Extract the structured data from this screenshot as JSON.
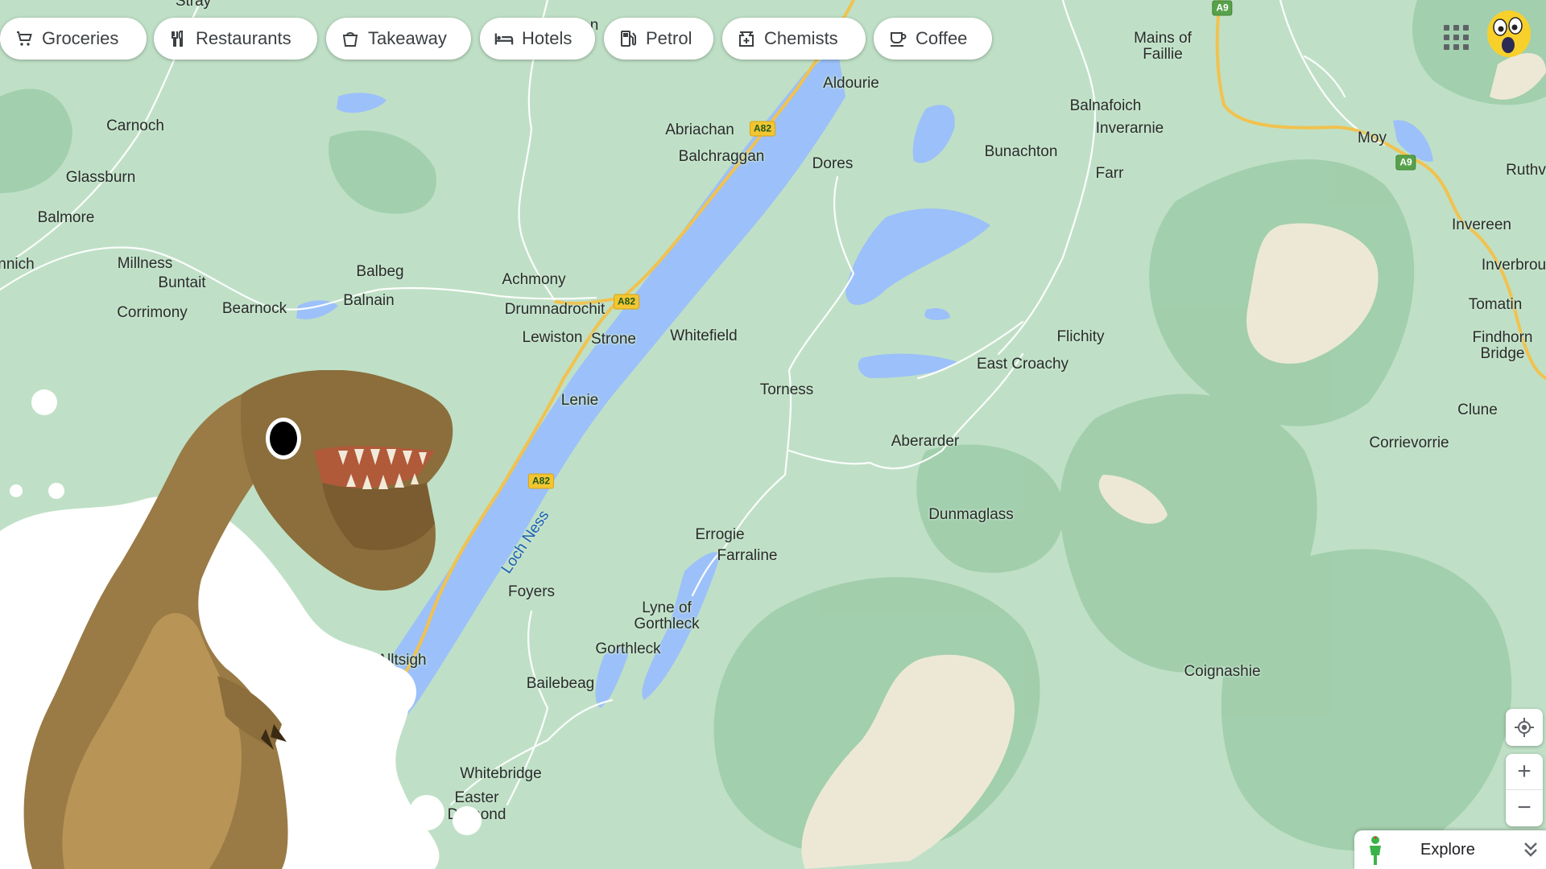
{
  "chips": [
    {
      "label": "Groceries",
      "icon": "cart-icon"
    },
    {
      "label": "Restaurants",
      "icon": "fork-knife-icon"
    },
    {
      "label": "Takeaway",
      "icon": "takeaway-bag-icon"
    },
    {
      "label": "Hotels",
      "icon": "bed-icon"
    },
    {
      "label": "Petrol",
      "icon": "fuel-pump-icon"
    },
    {
      "label": "Chemists",
      "icon": "pharmacy-icon"
    },
    {
      "label": "Coffee",
      "icon": "coffee-cup-icon"
    }
  ],
  "places": {
    "stray": "Stray",
    "n_partial": "n",
    "mains": "Mains of Faillie",
    "aldourie": "Aldourie",
    "balnafoich": "Balnafoich",
    "inverarnie": "Inverarnie",
    "moy": "Moy",
    "ruthv": "Ruthv",
    "carnoch": "Carnoch",
    "abriachan": "Abriachan",
    "balchraggan": "Balchraggan",
    "dores": "Dores",
    "bunachton": "Bunachton",
    "farr": "Farr",
    "glassburn": "Glassburn",
    "balmore": "Balmore",
    "invereen": "Invereen",
    "inverbrou": "Inverbrou",
    "nnich": "nnich",
    "millness": "Millness",
    "buntait": "Buntait",
    "corrimony": "Corrimony",
    "bearnock": "Bearnock",
    "balbeg": "Balbeg",
    "balnain": "Balnain",
    "achmony": "Achmony",
    "drumnadrochit": "Drumnadrochit",
    "lewiston": "Lewiston",
    "strone": "Strone",
    "whitefield": "Whitefield",
    "tomatin": "Tomatin",
    "findhorn": "Findhorn Bridge",
    "flichity": "Flichity",
    "east_croachy": "East Croachy",
    "torness": "Torness",
    "lenie": "Lenie",
    "clune": "Clune",
    "aberarder": "Aberarder",
    "corrievorrie": "Corrievorrie",
    "dunmaglass": "Dunmaglass",
    "errogie": "Errogie",
    "farraline": "Farraline",
    "loch_ness": "Loch Ness",
    "foyers": "Foyers",
    "lyne": "Lyne of Gorthleck",
    "gorthleck": "Gorthleck",
    "alltsigh": "Alltsigh",
    "coignashie": "Coignashie",
    "bailebeag": "Bailebeag",
    "whitebridge": "Whitebridge",
    "easter": "Easter",
    "drummond": "Dr   mond"
  },
  "roads": {
    "a82": "A82",
    "a9": "A9"
  },
  "controls": {
    "locate_icon": "my-location-icon",
    "zoom_in": "+",
    "zoom_out": "−",
    "explore": "Explore",
    "pegman_icon": "pegman-icon",
    "expand_icon": "chevron-double-down-icon",
    "apps_icon": "apps-grid-icon",
    "avatar_icon": "surprised-face-avatar-icon"
  },
  "colors": {
    "land": "#bfe0c6",
    "forest": "#9fcdaa",
    "hills": "#93c3a0",
    "water": "#9cc0f9",
    "moor": "#ede8d6",
    "main_road": "#f1c24f",
    "minor_road": "#ffffff"
  }
}
